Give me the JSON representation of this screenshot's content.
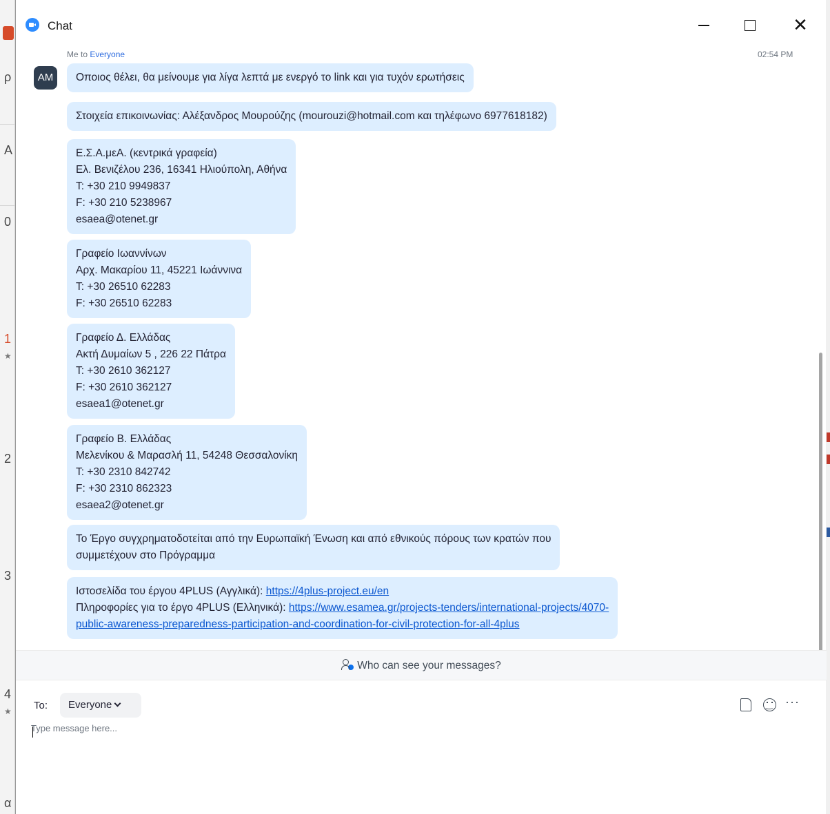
{
  "window": {
    "title": "Chat",
    "icon": "zoom-camera-icon"
  },
  "header": {
    "sender": "Me to ",
    "recipient": "Everyone",
    "timestamp": "02:54 PM"
  },
  "avatar": {
    "initials": "AM"
  },
  "messages": [
    {
      "text": "Οποιος θέλει, θα μείνουμε για λίγα λεπτά με ενεργό το link και για τυχόν ερωτήσεις"
    },
    {
      "text": "Στοιχεία επικοινωνίας: Αλέξανδρος Μουρούζης (mourouzi@hotmail.com και τηλέφωνο 6977618182)"
    },
    {
      "text": "Ε.Σ.Α.μεΑ. (κεντρικά γραφεία)\nΕλ. Βενιζέλου 236, 16341 Ηλιούπολη, Αθήνα\nT: +30 210 9949837\nF: +30 210 5238967\nesaea@otenet.gr"
    },
    {
      "text": "Γραφείο Ιωαννίνων\nΑρχ. Μακαρίου 11, 45221 Ιωάννινα\nT: +30 26510 62283\nF: +30 26510 62283"
    },
    {
      "text": "Γραφείο Δ. Ελλάδας\nΑκτή Δυμαίων 5 , 226 22 Πάτρα\nT: +30 2610 362127\nF: +30 2610 362127\nesaea1@otenet.gr"
    },
    {
      "text": "Γραφείο Β. Ελλάδας\nΜελενίκου & Μαρασλή 11, 54248 Θεσσαλονίκη\nT: +30 2310 842742\nF: +30 2310 862323\nesaea2@otenet.gr"
    },
    {
      "text": "Το Έργο συγχρηματοδοτείται από την Ευρωπαϊκή Ένωση και από εθνικούς πόρους των κρατών που\nσυμμετέχουν στο Πρόγραμμα"
    }
  ],
  "links_message": {
    "line1_prefix": "Ιστοσελίδα του έργου 4PLUS (Αγγλικά): ",
    "line1_link": "https://4plus-project.eu/en",
    "line2_prefix": "Πληροφορίες για το έργο 4PLUS (Ελληνικά): ",
    "line2_link_a": "https://www.esamea.gr/projects-tenders/international-projects/4070-",
    "line2_link_b": "public-awareness-preparedness-participation-and-coordination-for-civil-protection-for-all-4plus"
  },
  "privacy_bar": {
    "label": "Who can see your messages?",
    "icon": "people-icon"
  },
  "composer": {
    "to_label": "To:",
    "recipient": "Everyone",
    "placeholder": "Type message here...",
    "tools": [
      "file-icon",
      "emoji-icon",
      "more-icon"
    ],
    "more_label": "···"
  },
  "colors": {
    "bubble": "#ddeeff",
    "link": "#0b57d0",
    "accent": "#2d8cff",
    "avatar": "#2f3d4f"
  }
}
